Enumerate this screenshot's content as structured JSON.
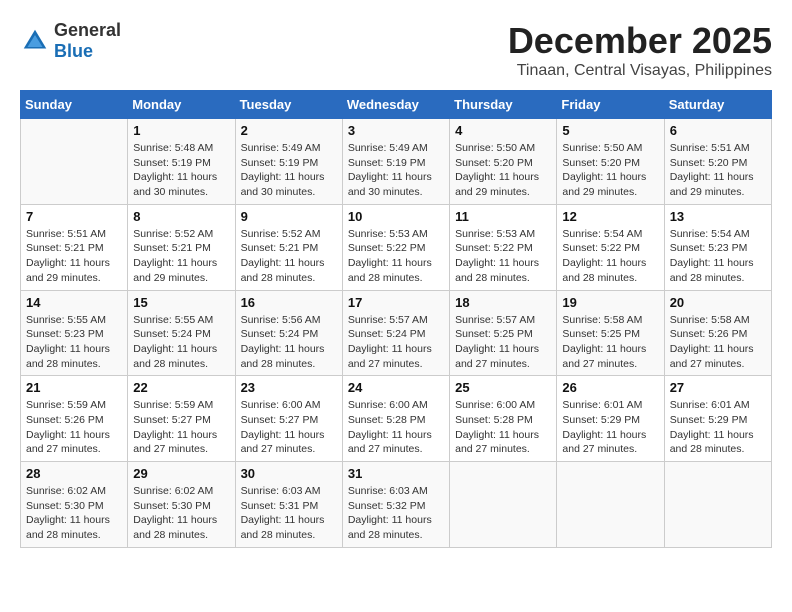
{
  "logo": {
    "text_general": "General",
    "text_blue": "Blue"
  },
  "title": "December 2025",
  "location": "Tinaan, Central Visayas, Philippines",
  "days_of_week": [
    "Sunday",
    "Monday",
    "Tuesday",
    "Wednesday",
    "Thursday",
    "Friday",
    "Saturday"
  ],
  "weeks": [
    [
      {
        "day": "",
        "sunrise": "",
        "sunset": "",
        "daylight": ""
      },
      {
        "day": "1",
        "sunrise": "Sunrise: 5:48 AM",
        "sunset": "Sunset: 5:19 PM",
        "daylight": "Daylight: 11 hours and 30 minutes."
      },
      {
        "day": "2",
        "sunrise": "Sunrise: 5:49 AM",
        "sunset": "Sunset: 5:19 PM",
        "daylight": "Daylight: 11 hours and 30 minutes."
      },
      {
        "day": "3",
        "sunrise": "Sunrise: 5:49 AM",
        "sunset": "Sunset: 5:19 PM",
        "daylight": "Daylight: 11 hours and 30 minutes."
      },
      {
        "day": "4",
        "sunrise": "Sunrise: 5:50 AM",
        "sunset": "Sunset: 5:20 PM",
        "daylight": "Daylight: 11 hours and 29 minutes."
      },
      {
        "day": "5",
        "sunrise": "Sunrise: 5:50 AM",
        "sunset": "Sunset: 5:20 PM",
        "daylight": "Daylight: 11 hours and 29 minutes."
      },
      {
        "day": "6",
        "sunrise": "Sunrise: 5:51 AM",
        "sunset": "Sunset: 5:20 PM",
        "daylight": "Daylight: 11 hours and 29 minutes."
      }
    ],
    [
      {
        "day": "7",
        "sunrise": "Sunrise: 5:51 AM",
        "sunset": "Sunset: 5:21 PM",
        "daylight": "Daylight: 11 hours and 29 minutes."
      },
      {
        "day": "8",
        "sunrise": "Sunrise: 5:52 AM",
        "sunset": "Sunset: 5:21 PM",
        "daylight": "Daylight: 11 hours and 29 minutes."
      },
      {
        "day": "9",
        "sunrise": "Sunrise: 5:52 AM",
        "sunset": "Sunset: 5:21 PM",
        "daylight": "Daylight: 11 hours and 28 minutes."
      },
      {
        "day": "10",
        "sunrise": "Sunrise: 5:53 AM",
        "sunset": "Sunset: 5:22 PM",
        "daylight": "Daylight: 11 hours and 28 minutes."
      },
      {
        "day": "11",
        "sunrise": "Sunrise: 5:53 AM",
        "sunset": "Sunset: 5:22 PM",
        "daylight": "Daylight: 11 hours and 28 minutes."
      },
      {
        "day": "12",
        "sunrise": "Sunrise: 5:54 AM",
        "sunset": "Sunset: 5:22 PM",
        "daylight": "Daylight: 11 hours and 28 minutes."
      },
      {
        "day": "13",
        "sunrise": "Sunrise: 5:54 AM",
        "sunset": "Sunset: 5:23 PM",
        "daylight": "Daylight: 11 hours and 28 minutes."
      }
    ],
    [
      {
        "day": "14",
        "sunrise": "Sunrise: 5:55 AM",
        "sunset": "Sunset: 5:23 PM",
        "daylight": "Daylight: 11 hours and 28 minutes."
      },
      {
        "day": "15",
        "sunrise": "Sunrise: 5:55 AM",
        "sunset": "Sunset: 5:24 PM",
        "daylight": "Daylight: 11 hours and 28 minutes."
      },
      {
        "day": "16",
        "sunrise": "Sunrise: 5:56 AM",
        "sunset": "Sunset: 5:24 PM",
        "daylight": "Daylight: 11 hours and 28 minutes."
      },
      {
        "day": "17",
        "sunrise": "Sunrise: 5:57 AM",
        "sunset": "Sunset: 5:24 PM",
        "daylight": "Daylight: 11 hours and 27 minutes."
      },
      {
        "day": "18",
        "sunrise": "Sunrise: 5:57 AM",
        "sunset": "Sunset: 5:25 PM",
        "daylight": "Daylight: 11 hours and 27 minutes."
      },
      {
        "day": "19",
        "sunrise": "Sunrise: 5:58 AM",
        "sunset": "Sunset: 5:25 PM",
        "daylight": "Daylight: 11 hours and 27 minutes."
      },
      {
        "day": "20",
        "sunrise": "Sunrise: 5:58 AM",
        "sunset": "Sunset: 5:26 PM",
        "daylight": "Daylight: 11 hours and 27 minutes."
      }
    ],
    [
      {
        "day": "21",
        "sunrise": "Sunrise: 5:59 AM",
        "sunset": "Sunset: 5:26 PM",
        "daylight": "Daylight: 11 hours and 27 minutes."
      },
      {
        "day": "22",
        "sunrise": "Sunrise: 5:59 AM",
        "sunset": "Sunset: 5:27 PM",
        "daylight": "Daylight: 11 hours and 27 minutes."
      },
      {
        "day": "23",
        "sunrise": "Sunrise: 6:00 AM",
        "sunset": "Sunset: 5:27 PM",
        "daylight": "Daylight: 11 hours and 27 minutes."
      },
      {
        "day": "24",
        "sunrise": "Sunrise: 6:00 AM",
        "sunset": "Sunset: 5:28 PM",
        "daylight": "Daylight: 11 hours and 27 minutes."
      },
      {
        "day": "25",
        "sunrise": "Sunrise: 6:00 AM",
        "sunset": "Sunset: 5:28 PM",
        "daylight": "Daylight: 11 hours and 27 minutes."
      },
      {
        "day": "26",
        "sunrise": "Sunrise: 6:01 AM",
        "sunset": "Sunset: 5:29 PM",
        "daylight": "Daylight: 11 hours and 27 minutes."
      },
      {
        "day": "27",
        "sunrise": "Sunrise: 6:01 AM",
        "sunset": "Sunset: 5:29 PM",
        "daylight": "Daylight: 11 hours and 28 minutes."
      }
    ],
    [
      {
        "day": "28",
        "sunrise": "Sunrise: 6:02 AM",
        "sunset": "Sunset: 5:30 PM",
        "daylight": "Daylight: 11 hours and 28 minutes."
      },
      {
        "day": "29",
        "sunrise": "Sunrise: 6:02 AM",
        "sunset": "Sunset: 5:30 PM",
        "daylight": "Daylight: 11 hours and 28 minutes."
      },
      {
        "day": "30",
        "sunrise": "Sunrise: 6:03 AM",
        "sunset": "Sunset: 5:31 PM",
        "daylight": "Daylight: 11 hours and 28 minutes."
      },
      {
        "day": "31",
        "sunrise": "Sunrise: 6:03 AM",
        "sunset": "Sunset: 5:32 PM",
        "daylight": "Daylight: 11 hours and 28 minutes."
      },
      {
        "day": "",
        "sunrise": "",
        "sunset": "",
        "daylight": ""
      },
      {
        "day": "",
        "sunrise": "",
        "sunset": "",
        "daylight": ""
      },
      {
        "day": "",
        "sunrise": "",
        "sunset": "",
        "daylight": ""
      }
    ]
  ]
}
